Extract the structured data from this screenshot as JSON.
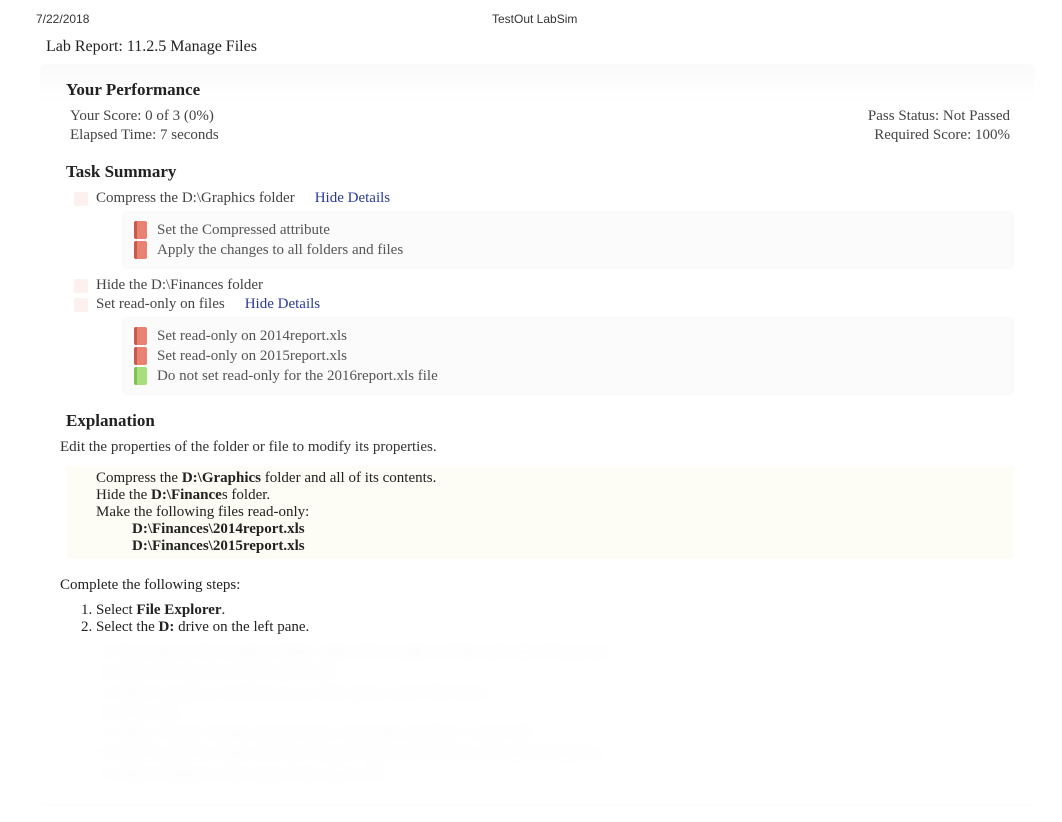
{
  "header": {
    "date": "7/22/2018",
    "app": "TestOut LabSim"
  },
  "lab_title": "Lab Report: 11.2.5 Manage Files",
  "performance": {
    "heading": "Your Performance",
    "score_label": "Your Score: 0 of 3 (0%)",
    "pass_status": "Pass Status: Not Passed",
    "elapsed": "Elapsed Time: 7 seconds",
    "required": "Required Score: 100%"
  },
  "task_summary": {
    "heading": "Task Summary",
    "hide_details": "Hide Details",
    "tasks": [
      {
        "label": "Compress the D:\\Graphics folder",
        "has_link": true,
        "details": [
          {
            "status": "red",
            "text": "Set the Compressed attribute"
          },
          {
            "status": "red",
            "text": "Apply the changes to all folders and files"
          }
        ]
      },
      {
        "label": "Hide the D:\\Finances folder",
        "has_link": false,
        "details": []
      },
      {
        "label": "Set read-only on files",
        "has_link": true,
        "details": [
          {
            "status": "red",
            "text": "Set read-only on 2014report.xls"
          },
          {
            "status": "red",
            "text": "Set read-only on 2015report.xls"
          },
          {
            "status": "green",
            "text": "Do not set read-only for the 2016report.xls file"
          }
        ]
      }
    ]
  },
  "explanation": {
    "heading": "Explanation",
    "intro": "Edit the properties of the folder or file to modify its properties.",
    "bullets": {
      "b1_pre": "Compress the ",
      "b1_bold": "D:\\Graphics",
      "b1_post": " folder and all of its contents.",
      "b2_pre": "Hide the ",
      "b2_bold": "D:\\Finance",
      "b2_post": "s folder.",
      "b3": "Make the following files read-only:",
      "sub1": "D:\\Finances\\2014report.xls",
      "sub2": "D:\\Finances\\2015report.xls"
    },
    "steps_intro": "Complete the following steps:",
    "steps": {
      "s1_pre": "Select ",
      "s1_bold": "File Explorer",
      "s1_post": ".",
      "s2_pre": "Select the ",
      "s2_bold": "D:",
      "s2_post": " drive on the left pane."
    },
    "faded": [
      "3. To compress the Graphics folder, right-click Graphics folder and select Properties.",
      "4. Select Advanced on the General tab.",
      "5. Select Compress contents to save disk space; select OK twice.",
      "6. Select OK.",
      "7. Select \"Apply changes to this folder, subfolders and files\"; select OK.",
      "8. To hide a folder, right-click the Finances folder in D:\\ drive and select Properties.",
      "9. Select Hidden on the General tab; select OK."
    ]
  }
}
